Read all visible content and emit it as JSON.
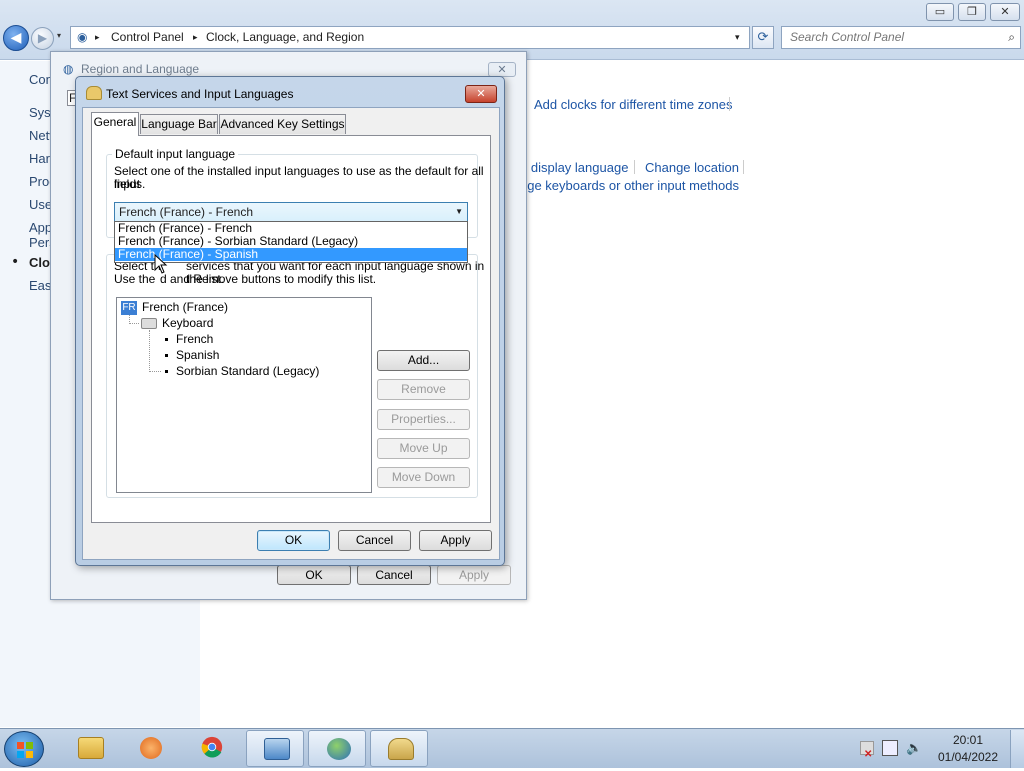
{
  "explorer": {
    "caption_buttons": {
      "minimize": "▭",
      "maximize": "❐",
      "close": "✕"
    },
    "back_glyph": "◀",
    "forward_glyph": "▶",
    "address": {
      "root_crumb": "Control Panel",
      "current_crumb": "Clock, Language, and Region",
      "separator": "▸",
      "dropdown": "▾"
    },
    "refresh_glyph": "⟳",
    "search": {
      "placeholder": "Search Control Panel",
      "icon": "search-icon"
    },
    "sidebar": {
      "items": [
        {
          "label": "Con"
        },
        {
          "label": "Syst"
        },
        {
          "label": "Netv"
        },
        {
          "label": "Harc"
        },
        {
          "label": "Prog"
        },
        {
          "label": "User"
        },
        {
          "label": "App"
        },
        {
          "label": "Pers"
        },
        {
          "label": "Cloc"
        },
        {
          "label": "Ease"
        }
      ],
      "current_marker": "•"
    },
    "links": {
      "add_clocks": "Add clocks for different time zones",
      "display_language": "e display language",
      "change_location": "Change location",
      "keyboards": "nge keyboards or other input methods"
    }
  },
  "region_dialog": {
    "title": "Region and Language",
    "close_glyph": "✕",
    "tab_stub": "F",
    "buttons": {
      "ok": "OK",
      "cancel": "Cancel",
      "apply": "Apply"
    }
  },
  "text_services_dialog": {
    "title": "Text Services and Input Languages",
    "close_glyph": "✕",
    "tabs": [
      {
        "label": "General",
        "selected": true
      },
      {
        "label": "Language Bar",
        "selected": false
      },
      {
        "label": "Advanced Key Settings",
        "selected": false
      }
    ],
    "default_input": {
      "group_label": "Default input language",
      "description_line1": "Select one of the installed input languages to use as the default for all input",
      "description_line2": "fields.",
      "selected_value": "French (France) - French",
      "dropdown_arrow": "▼",
      "options": [
        {
          "label": "French (France) - French",
          "highlighted": false
        },
        {
          "label": "French (France) - Sorbian Standard (Legacy)",
          "highlighted": false
        },
        {
          "label": "French (France) - Spanish",
          "highlighted": true
        }
      ]
    },
    "installed_services": {
      "description_line1": "Select the services that you want for each input language shown in the list.",
      "description_line2": "Use the Add and Remove buttons to modify this list.",
      "description_line1_visible": "Select th",
      "description_line1_tail": "services that you want for each input language shown in the list.",
      "description_line2_head": "Use the ",
      "description_line2_tail": "d and Remove buttons to modify this list.",
      "tree": {
        "language_badge": "FR",
        "language": "French (France)",
        "group": "Keyboard",
        "keyboards": [
          "French",
          "Spanish",
          "Sorbian Standard (Legacy)"
        ]
      },
      "buttons": {
        "add": "Add...",
        "remove": "Remove",
        "properties": "Properties...",
        "move_up": "Move Up",
        "move_down": "Move Down"
      }
    },
    "buttons": {
      "ok": "OK",
      "cancel": "Cancel",
      "apply": "Apply"
    }
  },
  "taskbar": {
    "items": [
      {
        "name": "windows-explorer",
        "active": false
      },
      {
        "name": "media-player",
        "active": false
      },
      {
        "name": "chrome",
        "active": false
      },
      {
        "name": "control-panel",
        "active": true
      },
      {
        "name": "region-language",
        "active": true
      },
      {
        "name": "text-services",
        "active": true
      }
    ],
    "clock": {
      "time": "20:01",
      "date": "01/04/2022"
    }
  },
  "colors": {
    "link": "#1d55a5",
    "highlight": "#3399ff",
    "close_red": "#c6432d"
  }
}
